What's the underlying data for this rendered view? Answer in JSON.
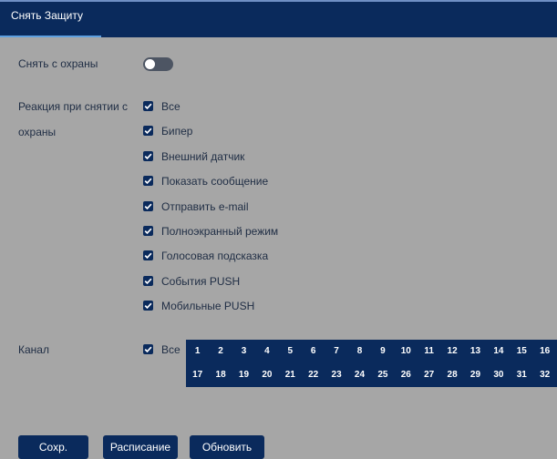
{
  "header": {
    "tab_label": "Снять Защиту"
  },
  "disarm": {
    "label": "Снять с охраны",
    "enabled": false
  },
  "reaction": {
    "label_line1": "Реакция при снятии с",
    "label_line2": "охраны",
    "items": [
      {
        "label": "Все",
        "checked": true
      },
      {
        "label": "Бипер",
        "checked": true
      },
      {
        "label": "Внешний датчик",
        "checked": true
      },
      {
        "label": "Показать сообщение",
        "checked": true
      },
      {
        "label": "Отправить e-mail",
        "checked": true
      },
      {
        "label": "Полноэкранный режим",
        "checked": true
      },
      {
        "label": "Голосовая подсказка",
        "checked": true
      },
      {
        "label": "События PUSH",
        "checked": true
      },
      {
        "label": "Мобильные PUSH",
        "checked": true
      }
    ]
  },
  "channel": {
    "label": "Канал",
    "all_label": "Все",
    "all_checked": true,
    "numbers": [
      "1",
      "2",
      "3",
      "4",
      "5",
      "6",
      "7",
      "8",
      "9",
      "10",
      "11",
      "12",
      "13",
      "14",
      "15",
      "16",
      "17",
      "18",
      "19",
      "20",
      "21",
      "22",
      "23",
      "24",
      "25",
      "26",
      "27",
      "28",
      "29",
      "30",
      "31",
      "32"
    ]
  },
  "buttons": {
    "save": "Сохр.",
    "schedule": "Расписание",
    "refresh": "Обновить"
  },
  "colors": {
    "background": "#a6a6a6",
    "accent": "#0a2a5c",
    "tab_underline": "#5ea0e0"
  }
}
